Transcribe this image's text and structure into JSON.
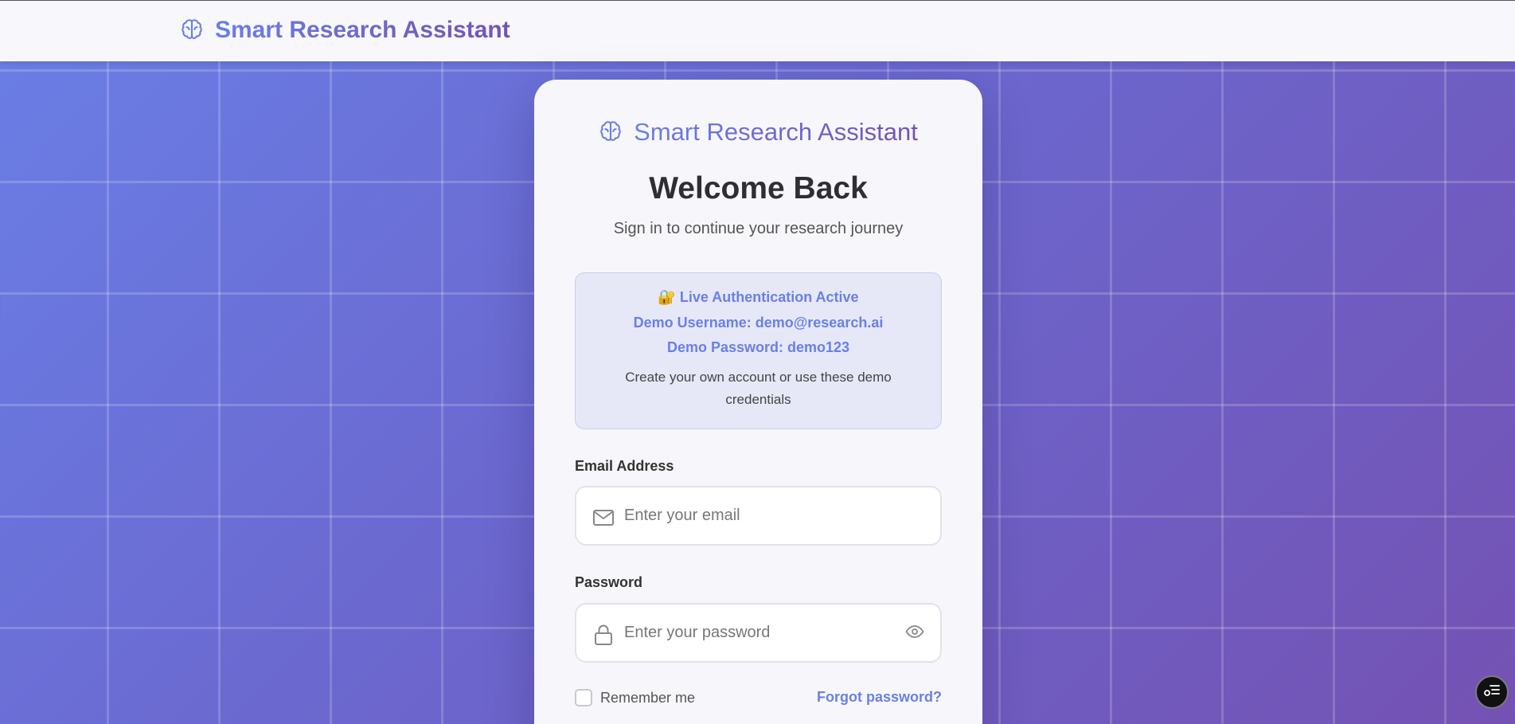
{
  "header": {
    "brand_title": "Smart Research Assistant",
    "brand_icon": "brain-icon"
  },
  "login_card": {
    "brand_title": "Smart Research Assistant",
    "brand_icon": "brain-icon",
    "heading": "Welcome Back",
    "subtitle": "Sign in to continue your research journey",
    "demo_info": {
      "status_icon": "🔐",
      "status_text": "Live Authentication Active",
      "username_line": "Demo Username: demo@research.ai",
      "password_line": "Demo Password: demo123",
      "note": "Create your own account or use these demo credentials"
    },
    "email": {
      "label": "Email Address",
      "placeholder": "Enter your email",
      "value": "",
      "icon": "mail-icon"
    },
    "password": {
      "label": "Password",
      "placeholder": "Enter your password",
      "value": "",
      "icon": "lock-icon",
      "toggle_icon": "eye-icon"
    },
    "remember_me": {
      "label": "Remember me",
      "checked": false
    },
    "forgot_link": "Forgot password?"
  },
  "floating_button": {
    "icon": "toggle-list-icon"
  },
  "colors": {
    "accent_start": "#6a7fe6",
    "accent_end": "#7452b3",
    "card_bg": "#f7f7fb",
    "demo_box_bg": "#e6e8f8",
    "heading_text": "#2e2e33"
  }
}
